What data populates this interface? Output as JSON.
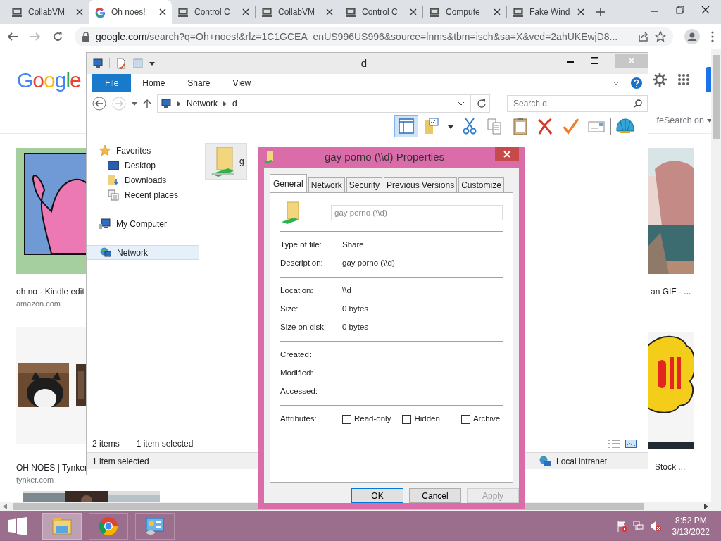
{
  "browser": {
    "tabs": [
      {
        "label": "CollabVM",
        "selected": false,
        "kind": "vm"
      },
      {
        "label": "Oh noes!",
        "selected": true,
        "kind": "google"
      },
      {
        "label": "Control C",
        "selected": false,
        "kind": "vm"
      },
      {
        "label": "CollabVM",
        "selected": false,
        "kind": "vm"
      },
      {
        "label": "Control C",
        "selected": false,
        "kind": "vm"
      },
      {
        "label": "Compute",
        "selected": false,
        "kind": "vm"
      },
      {
        "label": "Fake Wind",
        "selected": false,
        "kind": "vm"
      }
    ],
    "url_host": "google.com",
    "url_path": "/search?q=Oh+noes!&rlz=1C1GCEA_enUS996US996&source=lnms&tbm=isch&sa=X&ved=2ahUKEwjD8..."
  },
  "google": {
    "logo": "Google",
    "safesearch": "feSearch on",
    "results": [
      {
        "caption": "oh no - Kindle edit",
        "source": "amazon.com"
      },
      {
        "caption": "OH NOES | Tynker",
        "source": "tynker.com"
      },
      {
        "caption": "an GIF - ..."
      },
      {
        "caption": "Stock ..."
      }
    ]
  },
  "explorer": {
    "title": "d",
    "ribbon_tabs": [
      {
        "label": "File",
        "kind": "file"
      },
      {
        "label": "Home",
        "kind": "tab"
      },
      {
        "label": "Share",
        "kind": "tab"
      },
      {
        "label": "View",
        "kind": "tab"
      }
    ],
    "breadcrumb": [
      "Network",
      "d"
    ],
    "search": {
      "placeholder": "Search d"
    },
    "nav": [
      {
        "label": "Favorites",
        "kind": "star",
        "selected": false,
        "children": [
          {
            "label": "Desktop",
            "kind": "desktop",
            "selected": false
          },
          {
            "label": "Downloads",
            "kind": "downloads",
            "selected": false
          },
          {
            "label": "Recent places",
            "kind": "recent",
            "selected": false
          }
        ]
      },
      {
        "label": "My Computer",
        "kind": "computer",
        "selected": false
      },
      {
        "label": "Network",
        "kind": "network",
        "selected": true
      }
    ],
    "items": [
      {
        "label": "g",
        "selected": true
      }
    ],
    "status": {
      "count": "2 items",
      "selection": "1 item selected"
    },
    "details_bar": {
      "text": "1 item selected",
      "zone": "Local intranet"
    }
  },
  "dialog": {
    "title": "gay porno (\\\\d) Properties",
    "tabs": [
      {
        "label": "General",
        "selected": true
      },
      {
        "label": "Network",
        "selected": false
      },
      {
        "label": "Security",
        "selected": false
      },
      {
        "label": "Previous Versions",
        "selected": false
      },
      {
        "label": "Customize",
        "selected": false
      }
    ],
    "name_field": {
      "value": "gay porno (\\\\d)",
      "disabled": true
    },
    "groups": [
      [
        {
          "label": "Type of file:",
          "value": "Share"
        },
        {
          "label": "Description:",
          "value": "gay porno (\\\\d)"
        }
      ],
      [
        {
          "label": "Location:",
          "value": "\\\\d"
        },
        {
          "label": "Size:",
          "value": "0 bytes"
        },
        {
          "label": "Size on disk:",
          "value": "0 bytes"
        }
      ],
      [
        {
          "label": "Created:"
        },
        {
          "label": "Modified:"
        },
        {
          "label": "Accessed:"
        }
      ]
    ],
    "attributes_label": "Attributes:",
    "attributes": [
      {
        "label": "Read-only",
        "checked": false
      },
      {
        "label": "Hidden",
        "checked": false
      },
      {
        "label": "Archive",
        "checked": false
      }
    ],
    "buttons": [
      {
        "label": "OK",
        "kind": "default",
        "disabled": false
      },
      {
        "label": "Cancel",
        "kind": "normal",
        "disabled": false
      },
      {
        "label": "Apply",
        "kind": "normal",
        "disabled": true
      }
    ]
  },
  "taskbar": {
    "apps": [
      {
        "kind": "explorer",
        "active": true
      },
      {
        "kind": "chrome",
        "active": false
      },
      {
        "kind": "control",
        "active": false
      }
    ],
    "time": "8:52 PM",
    "date": "3/13/2022"
  }
}
